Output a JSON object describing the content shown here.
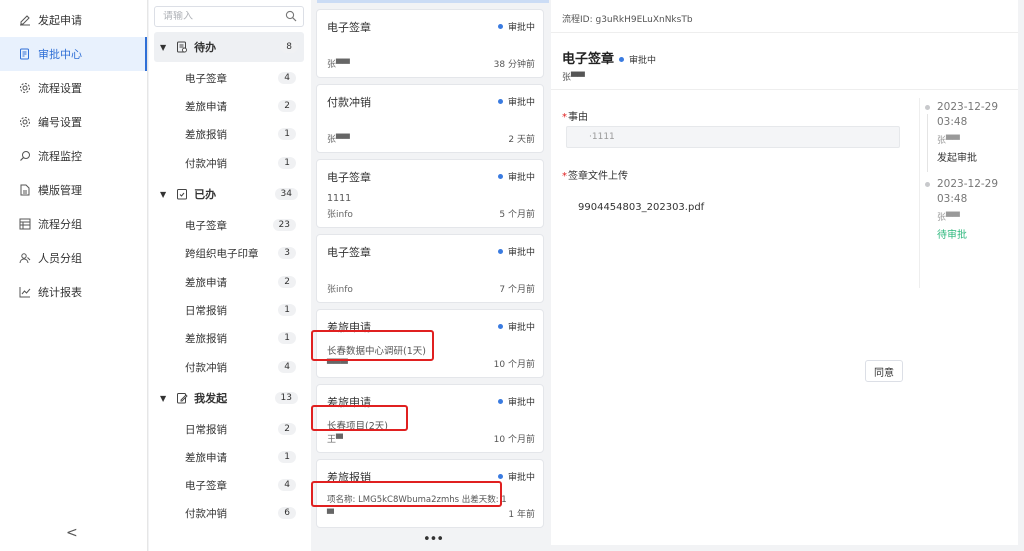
{
  "nav": {
    "items": [
      {
        "label": "发起申请",
        "icon": "edit-icon"
      },
      {
        "label": "审批中心",
        "icon": "approval-doc-icon"
      },
      {
        "label": "流程设置",
        "icon": "gear-icon"
      },
      {
        "label": "编号设置",
        "icon": "gear-icon"
      },
      {
        "label": "流程监控",
        "icon": "monitor-search-icon"
      },
      {
        "label": "模版管理",
        "icon": "document-icon"
      },
      {
        "label": "流程分组",
        "icon": "grid-icon"
      },
      {
        "label": "人员分组",
        "icon": "people-icon"
      },
      {
        "label": "统计报表",
        "icon": "line-chart-icon"
      }
    ],
    "active_index": 1,
    "collapse_glyph": "<"
  },
  "categories": {
    "search_placeholder": "请输入",
    "groups": [
      {
        "label": "待办",
        "count": "8",
        "items": [
          {
            "label": "电子签章",
            "count": "4"
          },
          {
            "label": "差旅申请",
            "count": "2"
          },
          {
            "label": "差旅报销",
            "count": "1"
          },
          {
            "label": "付款冲销",
            "count": "1"
          }
        ]
      },
      {
        "label": "已办",
        "count": "34",
        "items": [
          {
            "label": "电子签章",
            "count": "23"
          },
          {
            "label": "跨组织电子印章",
            "count": "3"
          },
          {
            "label": "差旅申请",
            "count": "2"
          },
          {
            "label": "日常报销",
            "count": "1"
          },
          {
            "label": "差旅报销",
            "count": "1"
          },
          {
            "label": "付款冲销",
            "count": "4"
          }
        ]
      },
      {
        "label": "我发起",
        "count": "13",
        "items": [
          {
            "label": "日常报销",
            "count": "2"
          },
          {
            "label": "差旅申请",
            "count": "1"
          },
          {
            "label": "电子签章",
            "count": "4"
          },
          {
            "label": "付款冲销",
            "count": "6"
          }
        ]
      }
    ]
  },
  "cards": [
    {
      "title": "电子签章",
      "status": "审批中",
      "desc": "",
      "user": "张▀▀",
      "time": "38 分钟前"
    },
    {
      "title": "付款冲销",
      "status": "审批中",
      "desc": "",
      "user": "张▀▀",
      "time": "2 天前"
    },
    {
      "title": "电子签章",
      "status": "审批中",
      "desc": "1111",
      "user": "张info",
      "time": "5 个月前"
    },
    {
      "title": "电子签章",
      "status": "审批中",
      "desc": "",
      "user": "张info",
      "time": "7 个月前"
    },
    {
      "title": "差旅申请",
      "status": "审批中",
      "desc": "长春数据中心调研(1天)",
      "user": "▀▀▀",
      "time": "10 个月前"
    },
    {
      "title": "差旅申请",
      "status": "审批中",
      "desc": "长春项目(2天)",
      "user": "王▀",
      "time": "10 个月前"
    },
    {
      "title": "差旅报销",
      "status": "审批中",
      "desc": "项名称: LMG5kC8Wbuma2zmhs 出差天数: 1",
      "user": "▀",
      "time": "1 年前"
    }
  ],
  "more_glyph": "•••",
  "detail": {
    "flow_id": "流程ID: g3uRkH9ELuXnNksTb",
    "title": "电子签章",
    "status": "审批中",
    "applicant": "张▀▀",
    "reason_label": "事由",
    "reason_value": "·1111",
    "upload_label": "签章文件上传",
    "file_name": "9904454803_202303.pdf",
    "agree_label": "同意",
    "timeline": [
      {
        "date": "2023-12-29",
        "time": "03:48",
        "user": "张▀▀",
        "action": "发起审批",
        "color": "#333333"
      },
      {
        "date": "2023-12-29",
        "time": "03:48",
        "user": "张▀▀",
        "action": "待审批",
        "color": "#2db87d"
      }
    ]
  },
  "colors": {
    "accent": "#2f6fd6",
    "status_dot": "#3a7be0",
    "highlight_box": "#e02020",
    "pending_green": "#2db87d"
  }
}
